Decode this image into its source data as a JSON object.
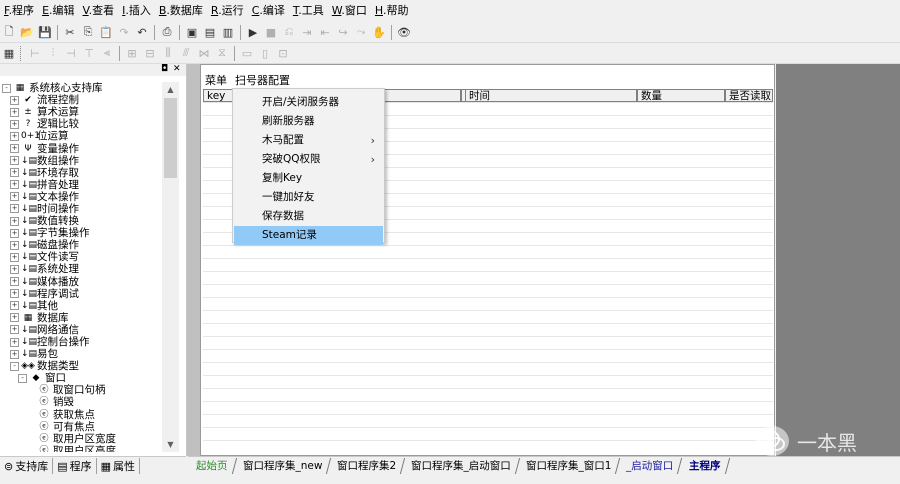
{
  "menubar": [
    {
      "key": "F",
      "label": ".程序"
    },
    {
      "key": "E",
      "label": ".编辑"
    },
    {
      "key": "V",
      "label": ".查看"
    },
    {
      "key": "I",
      "label": ".插入"
    },
    {
      "key": "B",
      "label": ".数据库"
    },
    {
      "key": "R",
      "label": ".运行"
    },
    {
      "key": "C",
      "label": ".编译"
    },
    {
      "key": "T",
      "label": ".工具"
    },
    {
      "key": "W",
      "label": ".窗口"
    },
    {
      "key": "H",
      "label": ".帮助"
    }
  ],
  "tree": [
    {
      "label": "系统核心支持库",
      "icon": "library-icon",
      "glyph": "▦",
      "level": 0,
      "pm": "-"
    },
    {
      "label": "流程控制",
      "icon": "check-icon",
      "glyph": "✔",
      "level": 1,
      "pm": "+"
    },
    {
      "label": "算术运算",
      "icon": "arith-icon",
      "glyph": "±",
      "level": 1,
      "pm": "+"
    },
    {
      "label": "逻辑比较",
      "icon": "question-icon",
      "glyph": "?",
      "level": 1,
      "pm": "+"
    },
    {
      "label": "位运算",
      "icon": "bit-icon",
      "glyph": "0+1",
      "level": 1,
      "pm": "+"
    },
    {
      "label": "变量操作",
      "icon": "variable-icon",
      "glyph": "Ψ",
      "level": 1,
      "pm": "+"
    },
    {
      "label": "数组操作",
      "icon": "func-icon",
      "glyph": "↓▤",
      "level": 1,
      "pm": "+"
    },
    {
      "label": "环境存取",
      "icon": "func-icon",
      "glyph": "↓▤",
      "level": 1,
      "pm": "+"
    },
    {
      "label": "拼音处理",
      "icon": "func-icon",
      "glyph": "↓▤",
      "level": 1,
      "pm": "+"
    },
    {
      "label": "文本操作",
      "icon": "func-icon",
      "glyph": "↓▤",
      "level": 1,
      "pm": "+"
    },
    {
      "label": "时间操作",
      "icon": "func-icon",
      "glyph": "↓▤",
      "level": 1,
      "pm": "+"
    },
    {
      "label": "数值转换",
      "icon": "func-icon",
      "glyph": "↓▤",
      "level": 1,
      "pm": "+"
    },
    {
      "label": "字节集操作",
      "icon": "func-icon",
      "glyph": "↓▤",
      "level": 1,
      "pm": "+"
    },
    {
      "label": "磁盘操作",
      "icon": "func-icon",
      "glyph": "↓▤",
      "level": 1,
      "pm": "+"
    },
    {
      "label": "文件读写",
      "icon": "func-icon",
      "glyph": "↓▤",
      "level": 1,
      "pm": "+"
    },
    {
      "label": "系统处理",
      "icon": "func-icon",
      "glyph": "↓▤",
      "level": 1,
      "pm": "+"
    },
    {
      "label": "媒体播放",
      "icon": "func-icon",
      "glyph": "↓▤",
      "level": 1,
      "pm": "+"
    },
    {
      "label": "程序调试",
      "icon": "func-icon",
      "glyph": "↓▤",
      "level": 1,
      "pm": "+"
    },
    {
      "label": "其他",
      "icon": "func-icon",
      "glyph": "↓▤",
      "level": 1,
      "pm": "+"
    },
    {
      "label": "数据库",
      "icon": "database-icon",
      "glyph": "▦",
      "level": 1,
      "pm": "+"
    },
    {
      "label": "网络通信",
      "icon": "func-icon",
      "glyph": "↓▤",
      "level": 1,
      "pm": "+"
    },
    {
      "label": "控制台操作",
      "icon": "func-icon",
      "glyph": "↓▤",
      "level": 1,
      "pm": "+"
    },
    {
      "label": "易包",
      "icon": "func-icon",
      "glyph": "↓▤",
      "level": 1,
      "pm": "+"
    },
    {
      "label": "数据类型",
      "icon": "datatype-icon",
      "glyph": "◈◈",
      "level": 1,
      "pm": "-"
    },
    {
      "label": "窗口",
      "icon": "window-type-icon",
      "glyph": "◆",
      "level": 2,
      "pm": "-"
    },
    {
      "label": "取窗口句柄",
      "icon": "method-icon",
      "glyph": "ⓔ",
      "level": 3,
      "pm": ""
    },
    {
      "label": "销毁",
      "icon": "method-icon",
      "glyph": "ⓔ",
      "level": 3,
      "pm": ""
    },
    {
      "label": "获取焦点",
      "icon": "method-icon",
      "glyph": "ⓔ",
      "level": 3,
      "pm": ""
    },
    {
      "label": "可有焦点",
      "icon": "method-icon",
      "glyph": "ⓔ",
      "level": 3,
      "pm": ""
    },
    {
      "label": "取用户区宽度",
      "icon": "method-icon",
      "glyph": "ⓔ",
      "level": 3,
      "pm": ""
    },
    {
      "label": "取用户区高度",
      "icon": "method-icon",
      "glyph": "ⓔ",
      "level": 3,
      "pm": ""
    }
  ],
  "lefttabs": [
    "支持库",
    "程序",
    "属性"
  ],
  "mainmenu": [
    "菜单",
    "扫号器配置"
  ],
  "columns": [
    "key",
    "",
    "时间",
    "数量",
    "是否读取"
  ],
  "dropdown": [
    {
      "label": "开启/关闭服务器",
      "submenu": false,
      "selected": false
    },
    {
      "label": "刷新服务器",
      "submenu": false,
      "selected": false
    },
    {
      "label": "木马配置",
      "submenu": true,
      "selected": false
    },
    {
      "label": "突破QQ权限",
      "submenu": true,
      "selected": false
    },
    {
      "label": "复制Key",
      "submenu": false,
      "selected": false
    },
    {
      "label": "一键加好友",
      "submenu": false,
      "selected": false
    },
    {
      "label": "保存数据",
      "submenu": false,
      "selected": false
    },
    {
      "label": "Steam记录",
      "submenu": false,
      "selected": true
    }
  ],
  "bottomtabs": [
    {
      "label": "起始页",
      "style": "green"
    },
    {
      "label": "窗口程序集_new",
      "style": ""
    },
    {
      "label": "窗口程序集2",
      "style": ""
    },
    {
      "label": "窗口程序集_启动窗口",
      "style": ""
    },
    {
      "label": "窗口程序集_窗口1",
      "style": ""
    },
    {
      "label": "_启动窗口",
      "style": "blue"
    },
    {
      "label": "主程序",
      "style": "bold"
    }
  ],
  "watermark": "一本黑",
  "colors": {
    "selected": "#91c9f7",
    "workspace": "#808080"
  }
}
